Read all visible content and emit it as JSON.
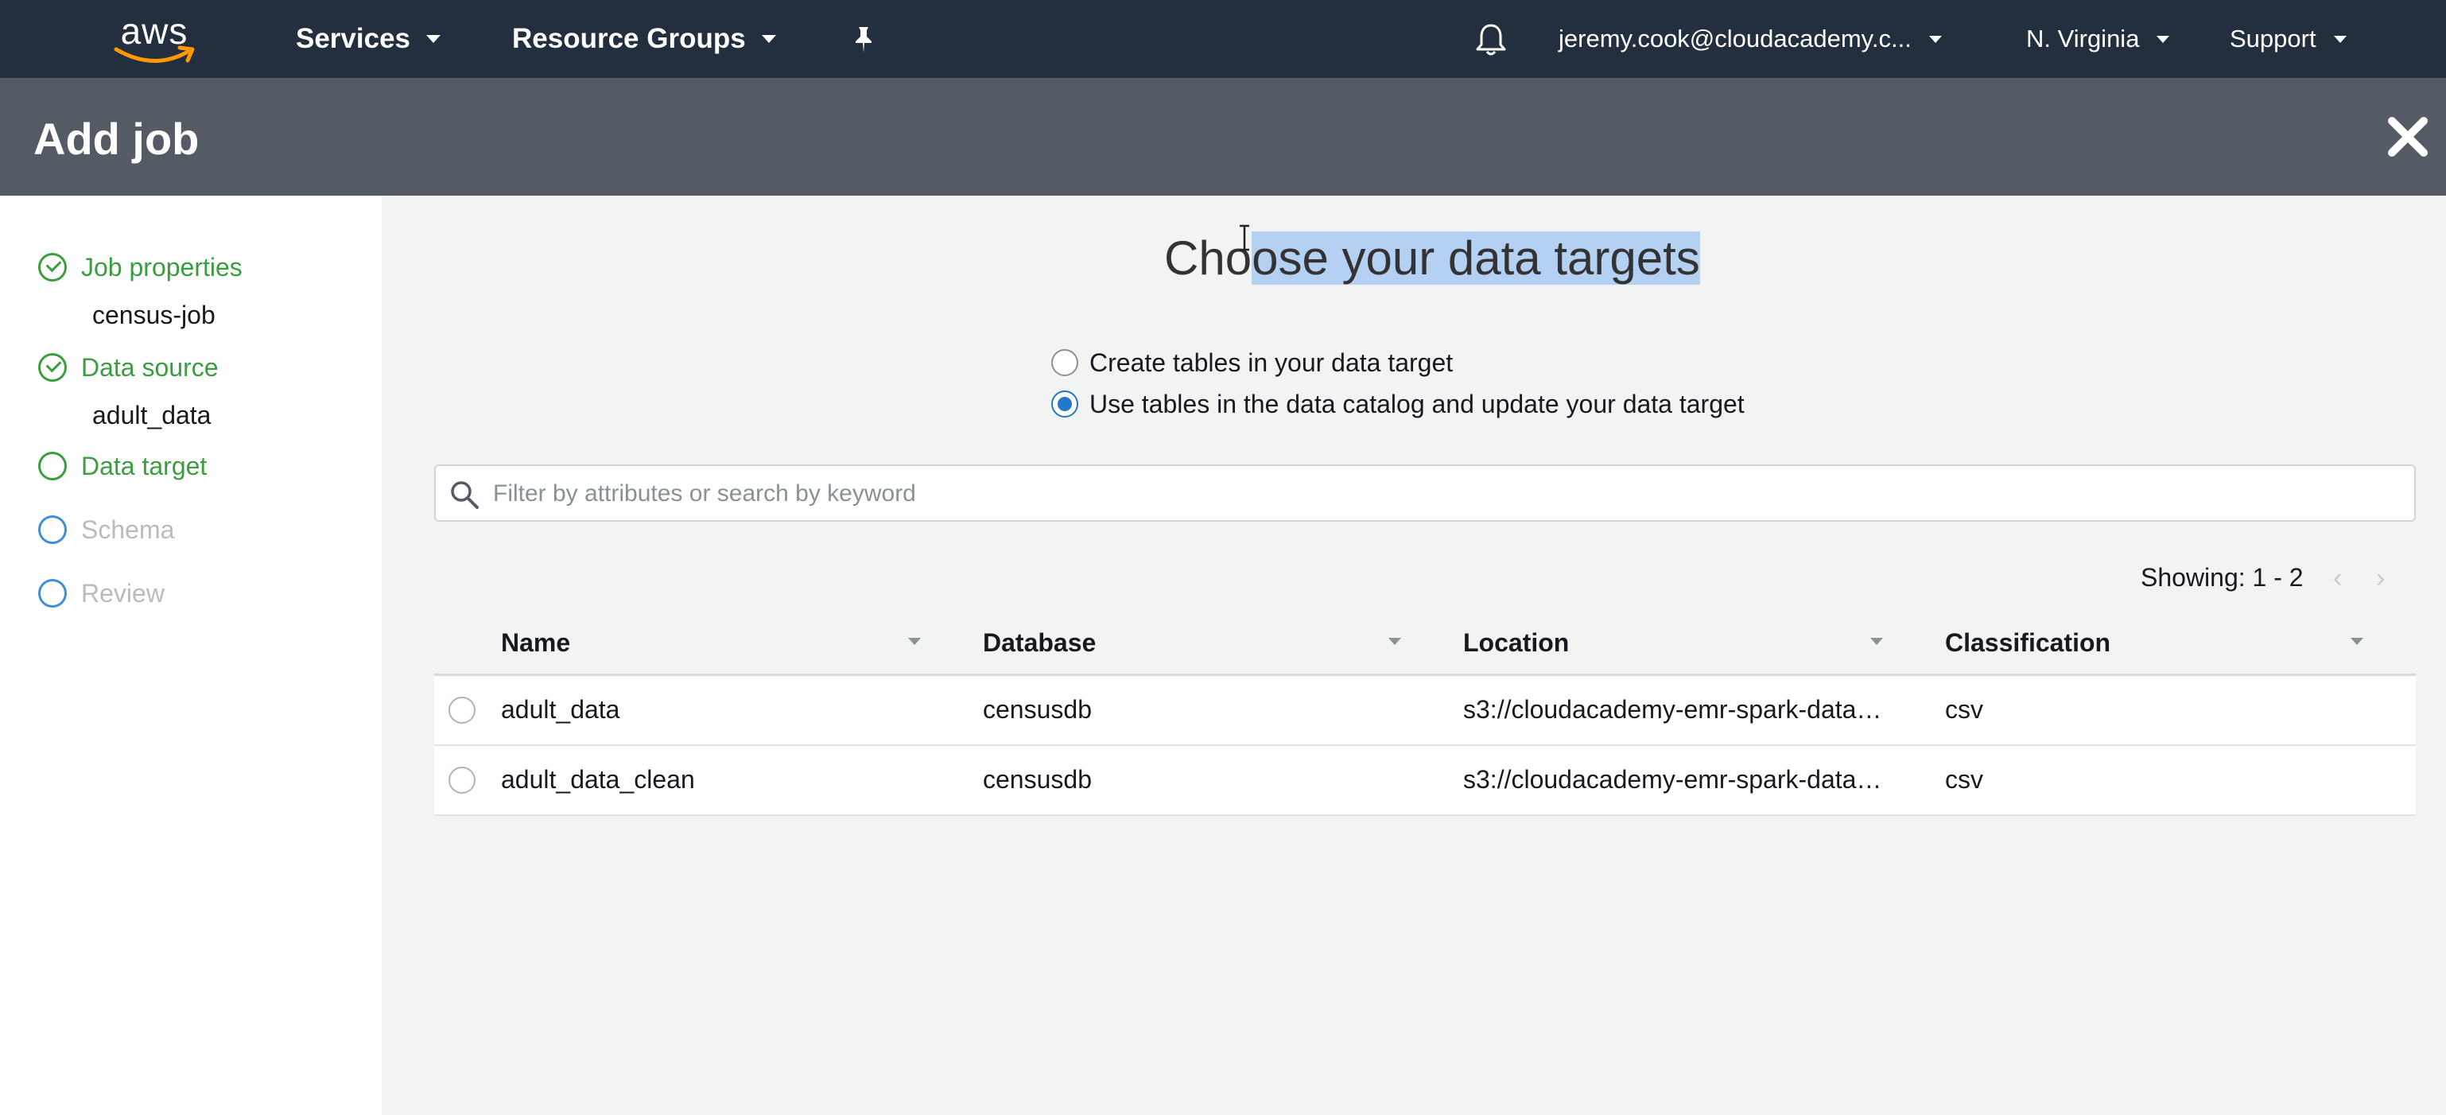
{
  "nav": {
    "logo": "aws",
    "services": "Services",
    "resource_groups": "Resource Groups",
    "account": "jeremy.cook@cloudacademy.c...",
    "region": "N. Virginia",
    "support": "Support"
  },
  "modal": {
    "title": "Add job"
  },
  "steps": [
    {
      "label": "Job properties",
      "sub": "census-job",
      "state": "done"
    },
    {
      "label": "Data source",
      "sub": "adult_data",
      "state": "done"
    },
    {
      "label": "Data target",
      "sub": "",
      "state": "current"
    },
    {
      "label": "Schema",
      "sub": "",
      "state": "pending"
    },
    {
      "label": "Review",
      "sub": "",
      "state": "pending"
    }
  ],
  "main": {
    "heading_plain": "Cho",
    "heading_selected": "ose your data targets",
    "options": [
      {
        "label": "Create tables in your data target",
        "checked": false
      },
      {
        "label": "Use tables in the data catalog and update your data target",
        "checked": true
      }
    ],
    "search_placeholder": "Filter by attributes or search by keyword",
    "showing": "Showing: 1 - 2"
  },
  "table": {
    "columns": [
      "Name",
      "Database",
      "Location",
      "Classification"
    ],
    "rows": [
      {
        "name": "adult_data",
        "database": "censusdb",
        "location": "s3://cloudacademy-emr-spark-data…",
        "classification": "csv"
      },
      {
        "name": "adult_data_clean",
        "database": "censusdb",
        "location": "s3://cloudacademy-emr-spark-data…",
        "classification": "csv"
      }
    ]
  },
  "colors": {
    "nav_bg": "#232f3e",
    "modal_header_bg": "#545b64",
    "step_done": "#3a9d3f",
    "step_pending": "#3f8fd2",
    "radio_selected": "#2178c9",
    "selection_highlight": "#b4d0f3"
  },
  "icons": [
    "aws-logo",
    "caret-down-icon",
    "pin-icon",
    "bell-icon",
    "close-icon",
    "check-circle-icon",
    "empty-circle-icon",
    "search-icon",
    "chevron-left-icon",
    "chevron-right-icon",
    "text-cursor-icon"
  ]
}
